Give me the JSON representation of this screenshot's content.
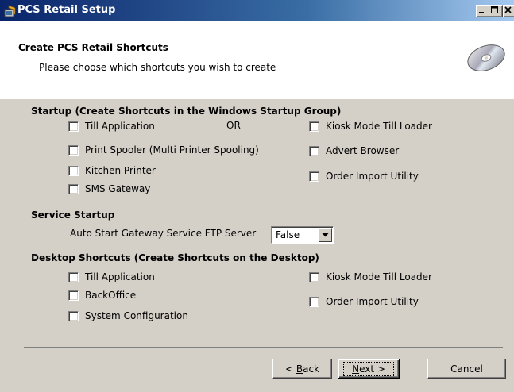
{
  "window": {
    "title": "PCS Retail Setup"
  },
  "header": {
    "title": "Create PCS Retail Shortcuts",
    "subtitle": "Please choose which shortcuts you wish to create"
  },
  "startup": {
    "heading": "Startup (Create Shortcuts in the Windows Startup Group)",
    "or_label": "OR",
    "left": [
      {
        "label": "Till Application",
        "checked": false
      },
      {
        "label": "Print Spooler (Multi Printer Spooling)",
        "checked": false
      },
      {
        "label": "Kitchen Printer",
        "checked": false
      },
      {
        "label": "SMS Gateway",
        "checked": false
      }
    ],
    "right": [
      {
        "label": "Kiosk Mode Till Loader",
        "checked": false
      },
      {
        "label": "Advert Browser",
        "checked": false
      },
      {
        "label": "Order Import Utility",
        "checked": false
      }
    ]
  },
  "service": {
    "heading": "Service Startup",
    "label": "Auto Start Gateway Service FTP Server",
    "value": "False"
  },
  "desktop": {
    "heading": "Desktop Shortcuts (Create Shortcuts on the Desktop)",
    "left": [
      {
        "label": "Till Application",
        "checked": false
      },
      {
        "label": "BackOffice",
        "checked": false
      },
      {
        "label": "System Configuration",
        "checked": false
      }
    ],
    "right": [
      {
        "label": "Kiosk Mode Till Loader",
        "checked": false
      },
      {
        "label": "Order Import Utility",
        "checked": false
      }
    ]
  },
  "buttons": {
    "back_prefix": "< ",
    "back_key": "B",
    "back_rest": "ack",
    "next_key": "N",
    "next_rest": "ext >",
    "cancel": "Cancel"
  },
  "icons": {
    "app": "setup-icon",
    "header": "cd-disc-icon",
    "minimize": "minimize-icon",
    "maximize": "maximize-icon",
    "close": "close-icon",
    "dropdown": "chevron-down-icon"
  }
}
